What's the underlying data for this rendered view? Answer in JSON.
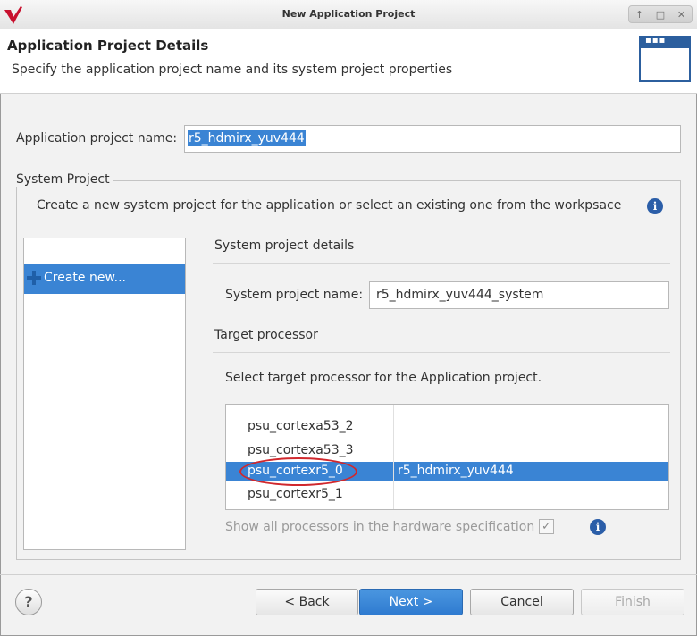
{
  "window": {
    "title": "New Application Project",
    "controls": [
      "↑",
      "□",
      "✕"
    ]
  },
  "banner": {
    "title": "Application Project Details",
    "subtitle": "Specify the application project name and its system project properties",
    "icon": "wizard-window-icon"
  },
  "project": {
    "label": "Application project name:",
    "value": "r5_hdmirx_yuv444"
  },
  "system_group": {
    "label": "System Project",
    "description": "Create a new system project for the application or select an existing one from the workpsace",
    "info_icon": "i"
  },
  "left_list": {
    "items": [
      {
        "label": "Create new...",
        "icon": "plus-icon",
        "selected": true
      }
    ]
  },
  "details": {
    "title": "System project details",
    "sys_label": "System project name:",
    "sys_value": "r5_hdmirx_yuv444_system"
  },
  "target": {
    "title": "Target processor",
    "description": "Select target processor for the Application project.",
    "rows": [
      {
        "processor": "psu_cortexa53_2",
        "app": "",
        "selected": false
      },
      {
        "processor": "psu_cortexa53_3",
        "app": "",
        "selected": false
      },
      {
        "processor": "psu_cortexr5_0",
        "app": "r5_hdmirx_yuv444",
        "selected": true
      },
      {
        "processor": "psu_cortexr5_1",
        "app": "",
        "selected": false
      }
    ],
    "show_all_label": "Show all processors in the hardware specification",
    "show_all_checked": true,
    "info_icon": "i"
  },
  "buttons": {
    "help": "?",
    "back": "< Back",
    "next": "Next >",
    "cancel": "Cancel",
    "finish": "Finish"
  },
  "colors": {
    "selection": "#3a84d4",
    "annotation": "#d0282d",
    "brand": "#c8102e"
  }
}
